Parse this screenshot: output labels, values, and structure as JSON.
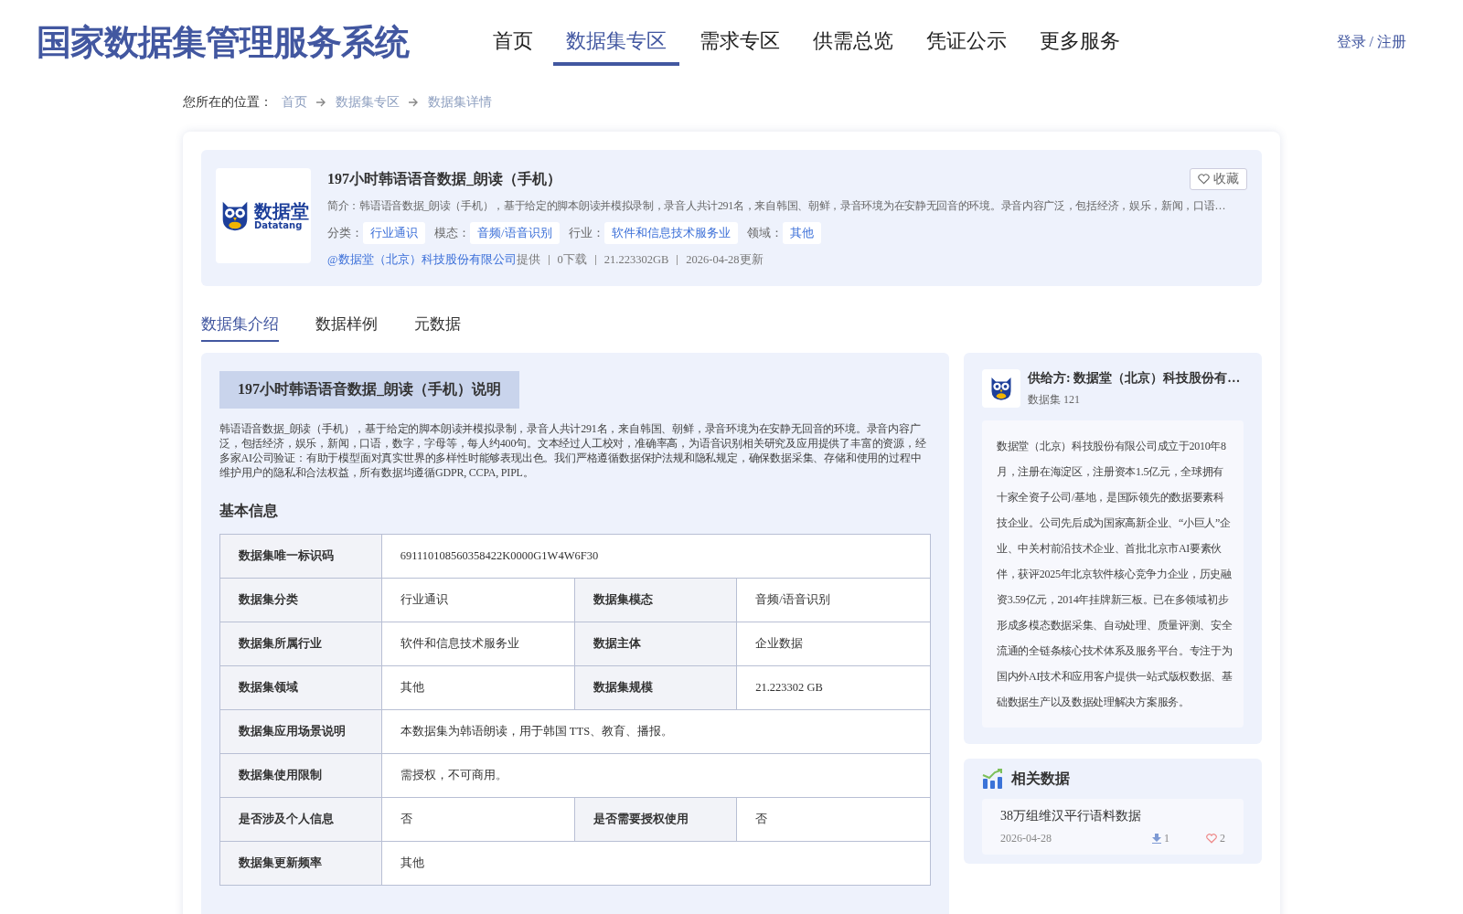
{
  "header": {
    "title": "国家数据集管理服务系统",
    "nav": [
      {
        "label": "首页",
        "selected": false
      },
      {
        "label": "数据集专区",
        "selected": true
      },
      {
        "label": "需求专区",
        "selected": false
      },
      {
        "label": "供需总览",
        "selected": false
      },
      {
        "label": "凭证公示",
        "selected": false
      },
      {
        "label": "更多服务",
        "selected": false
      }
    ],
    "login": "登录 / 注册"
  },
  "breadcrumb": {
    "label": "您所在的位置：",
    "items": [
      "首页",
      "数据集专区",
      "数据集详情"
    ]
  },
  "dataset": {
    "logo": {
      "name": "数据堂",
      "sub": "Datatang"
    },
    "title": "197小时韩语语音数据_朗读（手机）",
    "favorite": "收藏",
    "summary": "简介：韩语语音数据_朗读（手机），基于给定的脚本朗读并模拟录制，录音人共计291名，来自韩国、朝鲜，录音环境为在安静无回音的环境。录音内容广泛，包括经济，娱乐，新闻，口语…",
    "tags": [
      {
        "label": "分类：",
        "value": "行业通识"
      },
      {
        "label": "模态：",
        "value": "音频/语音识别"
      },
      {
        "label": "行业：",
        "value": "软件和信息技术服务业"
      },
      {
        "label": "领域：",
        "value": "其他"
      }
    ],
    "provider": "@数据堂（北京）科技股份有限公司",
    "provider_suffix": "提供",
    "stats": [
      "0下载",
      "21.223302GB",
      "2026-04-28更新"
    ]
  },
  "tabs": [
    {
      "label": "数据集介绍",
      "selected": true
    },
    {
      "label": "数据样例",
      "selected": false
    },
    {
      "label": "元数据",
      "selected": false
    }
  ],
  "intro": {
    "heading": "197小时韩语语音数据_朗读（手机）说明",
    "text": "韩语语音数据_朗读（手机），基于给定的脚本朗读并模拟录制，录音人共计291名，来自韩国、朝鲜，录音环境为在安静无回音的环境。录音内容广泛，包括经济，娱乐，新闻，口语，数字，字母等，每人约400句。文本经过人工校对，准确率高，为语音识别相关研究及应用提供了丰富的资源，经多家AI公司验证：有助于模型面对真实世界的多样性时能够表现出色。我们严格遵循数据保护法规和隐私规定，确保数据采集、存储和使用的过程中维护用户的隐私和合法权益，所有数据均遵循GDPR, CCPA, PIPL。",
    "info_title": "基本信息",
    "rows": [
      [
        {
          "label": "数据集唯一标识码",
          "value": "691110108560358422K0000G1W4W6F30"
        }
      ],
      [
        {
          "label": "数据集分类",
          "value": "行业通识"
        },
        {
          "label": "数据集模态",
          "value": "音频/语音识别"
        }
      ],
      [
        {
          "label": "数据集所属行业",
          "value": "软件和信息技术服务业"
        },
        {
          "label": "数据主体",
          "value": "企业数据"
        }
      ],
      [
        {
          "label": "数据集领域",
          "value": "其他"
        },
        {
          "label": "数据集规模",
          "value": "21.223302 GB"
        }
      ],
      [
        {
          "label": "数据集应用场景说明",
          "value": "本数据集为韩语朗读，用于韩国 TTS、教育、播报。"
        }
      ],
      [
        {
          "label": "数据集使用限制",
          "value": "需授权，不可商用。"
        }
      ],
      [
        {
          "label": "是否涉及个人信息",
          "value": "否"
        },
        {
          "label": "是否需要授权使用",
          "value": "否"
        }
      ],
      [
        {
          "label": "数据集更新频率",
          "value": "其他"
        }
      ]
    ]
  },
  "supplier": {
    "name": "供给方: 数据堂（北京）科技股份有…",
    "count": "数据集 121",
    "description": "数据堂（北京）科技股份有限公司成立于2010年8月，注册在海淀区，注册资本1.5亿元，全球拥有十家全资子公司/基地，是国际领先的数据要素科技企业。公司先后成为国家高新企业、“小巨人”企业、中关村前沿技术企业、首批北京市AI要素伙伴，获评2025年北京软件核心竞争力企业，历史融资3.59亿元，2014年挂牌新三板。已在多领域初步形成多模态数据采集、自动处理、质量评测、安全流通的全链条核心技术体系及服务平台。专注于为国内外AI技术和应用客户提供一站式版权数据、基础数据生产以及数据处理解决方案服务。"
  },
  "related": {
    "title": "相关数据",
    "items": [
      {
        "title": "38万组维汉平行语料数据",
        "date": "2026-04-28",
        "downloads": "1",
        "likes": "2"
      }
    ]
  }
}
